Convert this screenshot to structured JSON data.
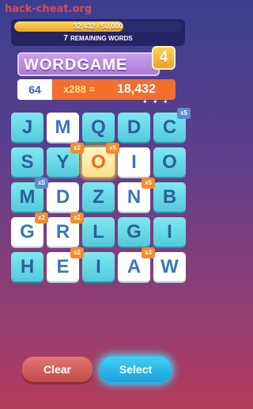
{
  "watermark": "hack-cheat.org",
  "progress": {
    "text": "32,432 / 50,000",
    "fraction": 0.6486,
    "remaining_count": "7",
    "remaining_label": "REMAINING WORDS"
  },
  "title": "WORDGAME",
  "level": "4",
  "score": {
    "base": "64",
    "multiplier": "x288 =",
    "total": "18,432"
  },
  "sparkles": "✦ ✦ ✦",
  "tiles": [
    {
      "letter": "J",
      "style": "cyan",
      "row": 0,
      "col": 0
    },
    {
      "letter": "M",
      "style": "white",
      "row": 0,
      "col": 1
    },
    {
      "letter": "Q",
      "style": "cyan",
      "row": 0,
      "col": 2
    },
    {
      "letter": "D",
      "style": "cyan",
      "row": 0,
      "col": 3
    },
    {
      "letter": "C",
      "style": "cyan",
      "row": 0,
      "col": 4
    },
    {
      "letter": "S",
      "style": "cyan",
      "row": 1,
      "col": 0
    },
    {
      "letter": "Y",
      "style": "cyan",
      "row": 1,
      "col": 1
    },
    {
      "letter": "O",
      "style": "selected",
      "row": 1,
      "col": 2
    },
    {
      "letter": "I",
      "style": "white",
      "row": 1,
      "col": 3
    },
    {
      "letter": "O",
      "style": "cyan",
      "row": 1,
      "col": 4
    },
    {
      "letter": "M",
      "style": "cyan",
      "row": 2,
      "col": 0
    },
    {
      "letter": "D",
      "style": "white",
      "row": 2,
      "col": 1
    },
    {
      "letter": "Z",
      "style": "cyan",
      "row": 2,
      "col": 2
    },
    {
      "letter": "N",
      "style": "white",
      "row": 2,
      "col": 3
    },
    {
      "letter": "B",
      "style": "cyan",
      "row": 2,
      "col": 4
    },
    {
      "letter": "G",
      "style": "white",
      "row": 3,
      "col": 0
    },
    {
      "letter": "R",
      "style": "white",
      "row": 3,
      "col": 1
    },
    {
      "letter": "L",
      "style": "cyan",
      "row": 3,
      "col": 2
    },
    {
      "letter": "G",
      "style": "cyan",
      "row": 3,
      "col": 3
    },
    {
      "letter": "I",
      "style": "cyan",
      "row": 3,
      "col": 4
    },
    {
      "letter": "H",
      "style": "cyan",
      "row": 4,
      "col": 0
    },
    {
      "letter": "E",
      "style": "white",
      "row": 4,
      "col": 1
    },
    {
      "letter": "I",
      "style": "cyan",
      "row": 4,
      "col": 2
    },
    {
      "letter": "A",
      "style": "white",
      "row": 4,
      "col": 3
    },
    {
      "letter": "W",
      "style": "white",
      "row": 4,
      "col": 4
    }
  ],
  "multipliers": [
    {
      "label": "x5",
      "color": "blue",
      "row": 0,
      "col": 4
    },
    {
      "label": "x6",
      "color": "orange",
      "row": 1,
      "col": 2
    },
    {
      "label": "x2",
      "color": "orange",
      "row": 1,
      "col": 1
    },
    {
      "label": "x5",
      "color": "blue",
      "row": 2,
      "col": 0
    },
    {
      "label": "x5",
      "color": "orange",
      "row": 2,
      "col": 3
    },
    {
      "label": "x2",
      "color": "orange",
      "row": 3,
      "col": 0
    },
    {
      "label": "x2",
      "color": "orange",
      "row": 3,
      "col": 1
    },
    {
      "label": "x2",
      "color": "orange",
      "row": 4,
      "col": 1
    },
    {
      "label": "x3",
      "color": "orange",
      "row": 4,
      "col": 3
    }
  ],
  "buttons": {
    "clear": "Clear",
    "select": "Select"
  },
  "colors": {
    "tile_cyan": "#6edde9",
    "tile_white": "#ffffff",
    "tile_selected": "#ffe08c",
    "accent_orange": "#f46e2e",
    "button_clear": "#c34a48",
    "button_select": "#1e9fdc"
  }
}
